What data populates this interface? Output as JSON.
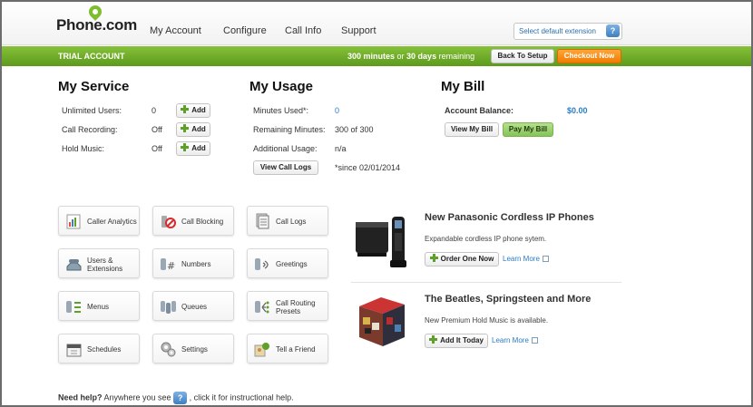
{
  "header": {
    "logo": "Phone.com",
    "nav": [
      "My Account",
      "Configure",
      "Call Info",
      "Support"
    ],
    "extension_select": "Select default extension",
    "help": "?"
  },
  "trial_bar": {
    "label": "TRIAL ACCOUNT",
    "minutes": "300 minutes",
    "or": " or ",
    "days": "30 days",
    "remaining": " remaining",
    "back_to_setup": "Back To Setup",
    "checkout": "Checkout Now"
  },
  "my_service": {
    "title": "My Service",
    "rows": [
      {
        "label": "Unlimited Users:",
        "value": "0",
        "button": "Add"
      },
      {
        "label": "Call Recording:",
        "value": "Off",
        "button": "Add"
      },
      {
        "label": "Hold Music:",
        "value": "Off",
        "button": "Add"
      }
    ]
  },
  "my_usage": {
    "title": "My Usage",
    "rows": [
      {
        "label": "Minutes Used*:",
        "value": "0"
      },
      {
        "label": "Remaining Minutes:",
        "value": "300 of 300"
      },
      {
        "label": "Additional Usage:",
        "value": "n/a"
      }
    ],
    "view_logs": "View Call Logs",
    "since": "*since 02/01/2014"
  },
  "my_bill": {
    "title": "My Bill",
    "balance_label": "Account Balance:",
    "balance_value": "$0.00",
    "view_bill": "View My Bill",
    "pay_bill": "Pay My Bill"
  },
  "features": [
    {
      "label": "Caller Analytics",
      "icon": "chart-icon"
    },
    {
      "label": "Call Blocking",
      "icon": "block-icon"
    },
    {
      "label": "Call Logs",
      "icon": "logs-icon"
    },
    {
      "label": "Users & Extensions",
      "icon": "phone-icon"
    },
    {
      "label": "Numbers",
      "icon": "numbers-icon"
    },
    {
      "label": "Greetings",
      "icon": "greetings-icon"
    },
    {
      "label": "Menus",
      "icon": "menus-icon"
    },
    {
      "label": "Queues",
      "icon": "queues-icon"
    },
    {
      "label": "Call Routing Presets",
      "icon": "routing-icon"
    },
    {
      "label": "Schedules",
      "icon": "schedules-icon"
    },
    {
      "label": "Settings",
      "icon": "gear-icon"
    },
    {
      "label": "Tell a Friend",
      "icon": "friend-icon"
    }
  ],
  "promos": [
    {
      "title": "New Panasonic Cordless IP Phones",
      "desc": "Expandable cordless IP phone sytem.",
      "button": "Order One Now",
      "link": "Learn More"
    },
    {
      "title": "The Beatles, Springsteen and More",
      "desc": "New Premium Hold Music is available.",
      "button": "Add It Today",
      "link": "Learn More"
    }
  ],
  "help_line": {
    "bold": "Need help?",
    "pre": " Anywhere you see ",
    "icon": "?",
    "post": " , click it for instructional help."
  },
  "colors": {
    "green_bar": "#6fae28",
    "orange": "#f58a0b",
    "link_blue": "#2a7cc7"
  }
}
